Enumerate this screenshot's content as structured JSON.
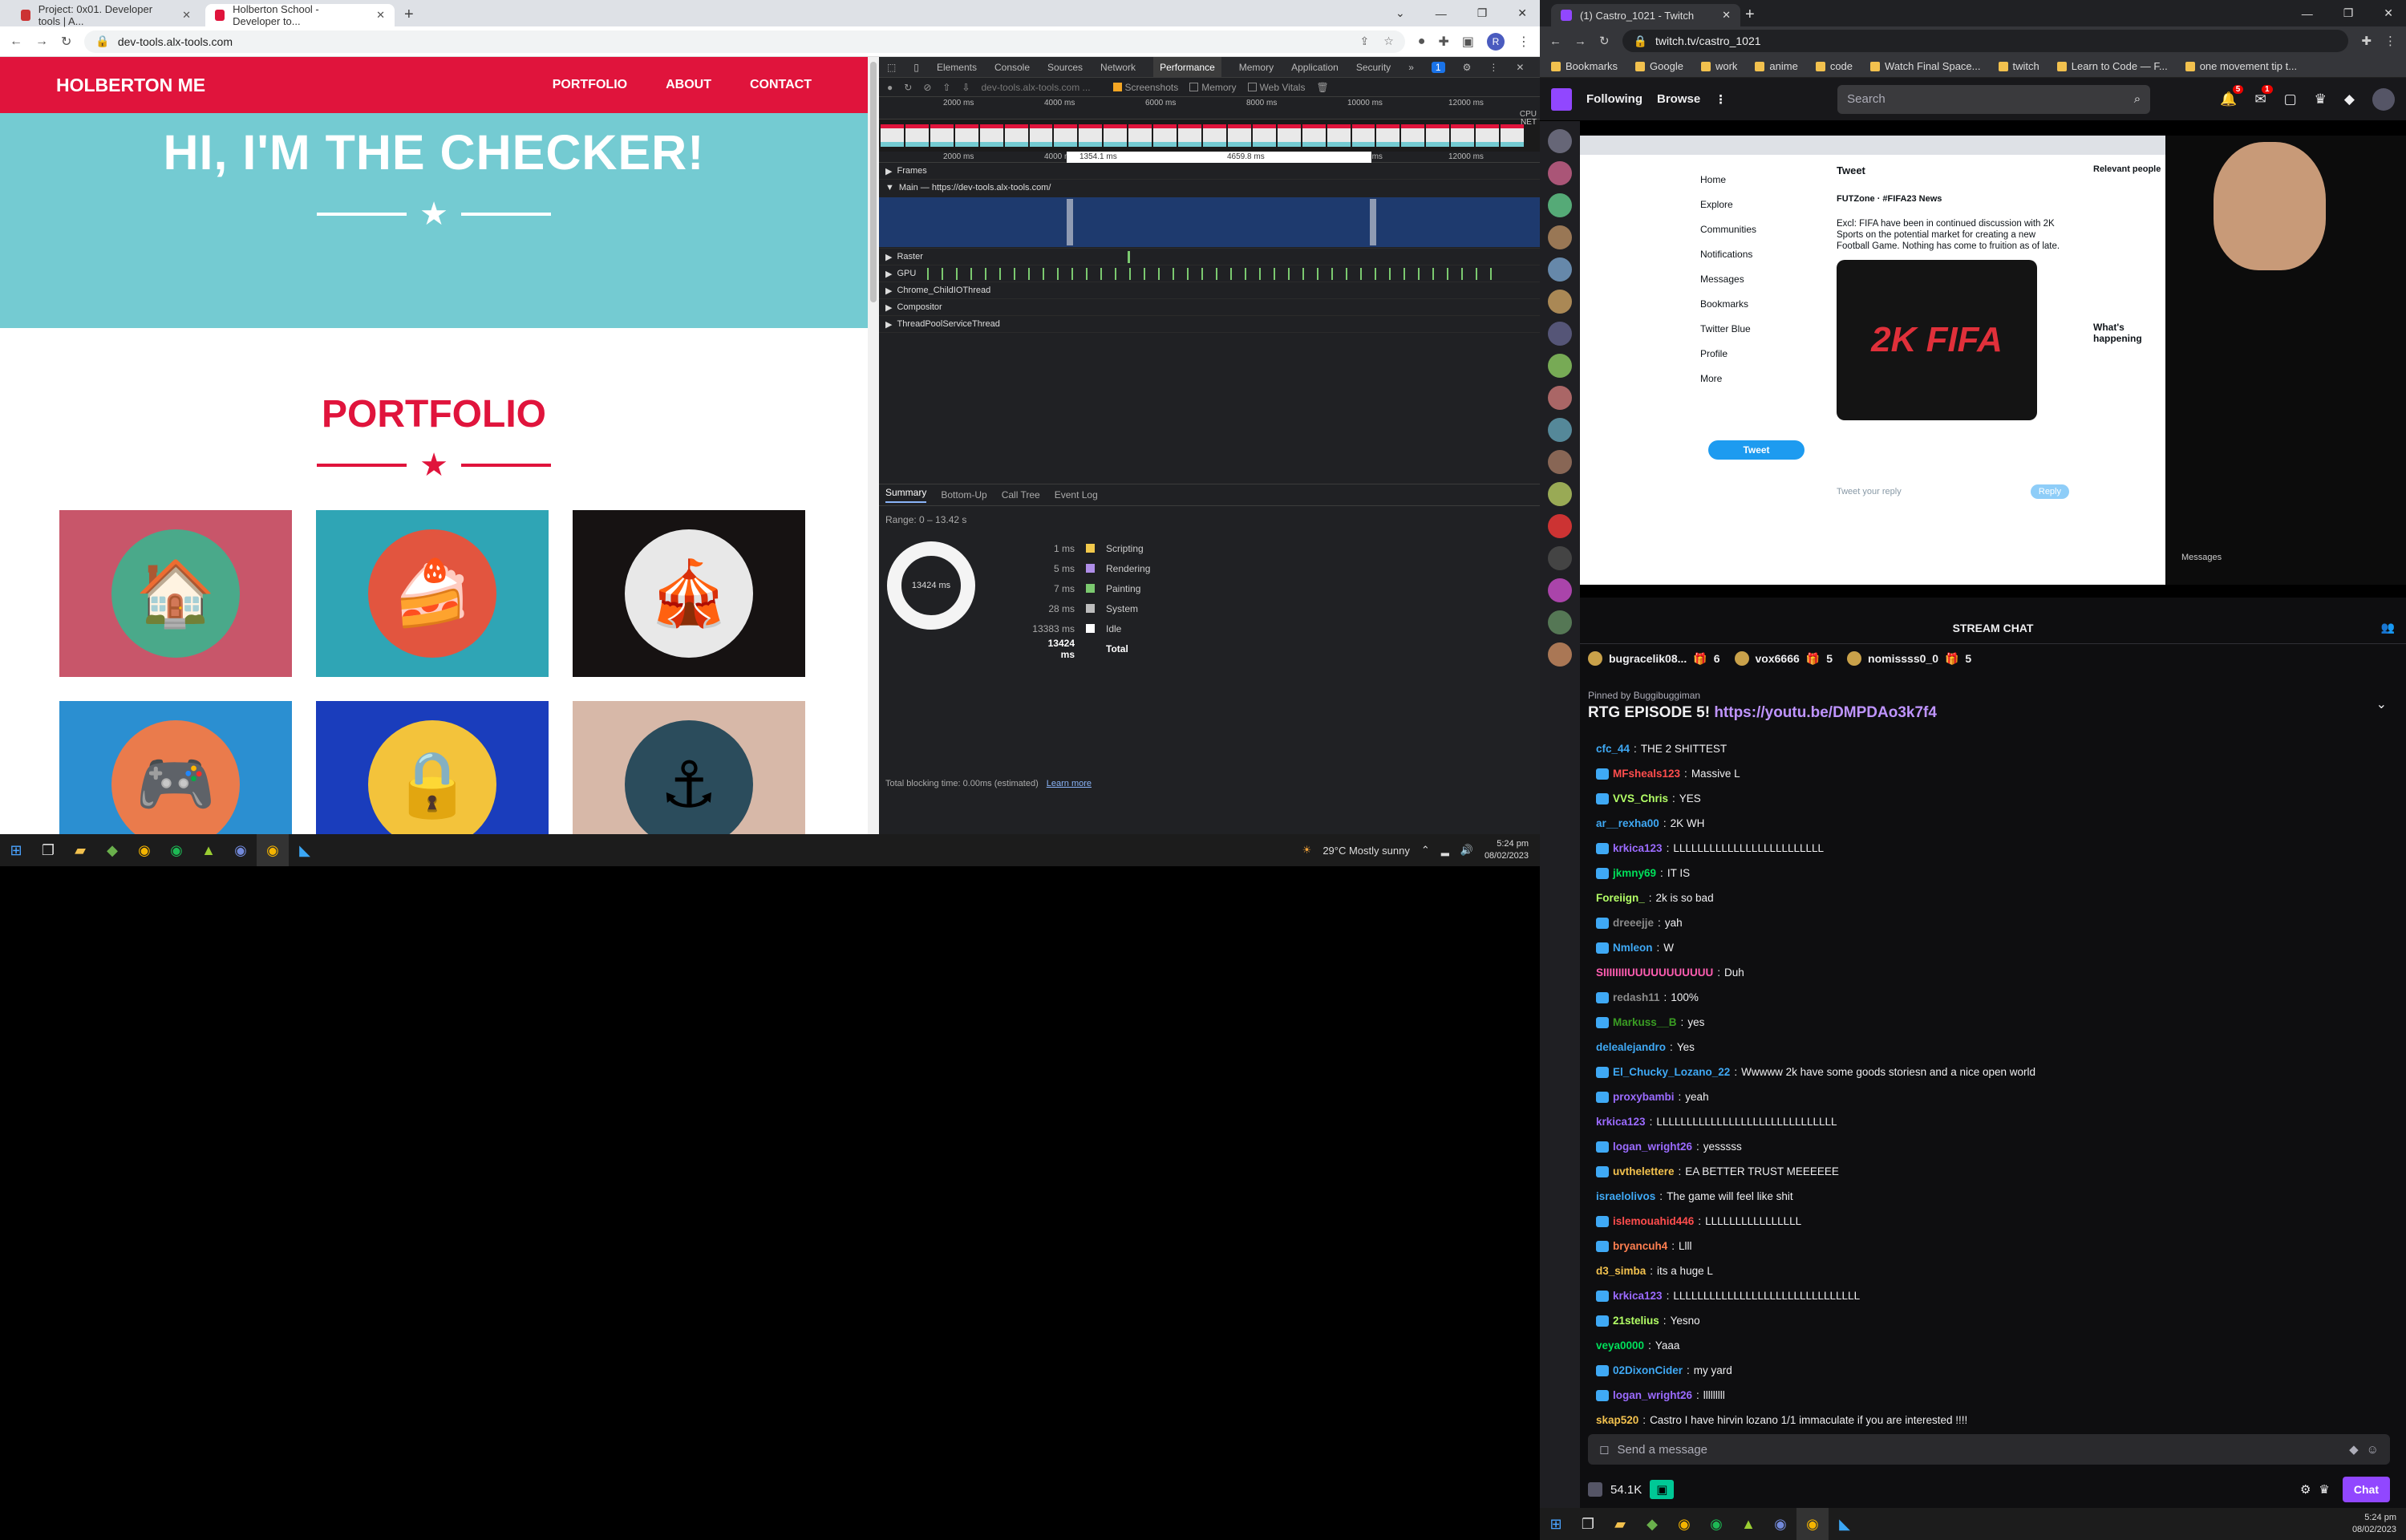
{
  "left_browser": {
    "tabs": [
      {
        "title": "Project: 0x01. Developer tools | A...",
        "active": false
      },
      {
        "title": "Holberton School - Developer to...",
        "active": true
      }
    ],
    "url": "dev-tools.alx-tools.com",
    "avatar_letter": "R"
  },
  "site": {
    "brand": "HOLBERTON ME",
    "nav": [
      "PORTFOLIO",
      "ABOUT",
      "CONTACT"
    ],
    "hero_title": "HI, I'M THE CHECKER!",
    "portfolio_title": "PORTFOLIO",
    "colors": {
      "accent": "#e0143c",
      "hero": "#74cbd2"
    },
    "cards": [
      {
        "bg": "#c8566a",
        "circle": "#4aa98a",
        "icon": "cabin-icon",
        "glyph": "🏠"
      },
      {
        "bg": "#2fa5b5",
        "circle": "#e2553f",
        "icon": "cake-icon",
        "glyph": "🍰"
      },
      {
        "bg": "#161212",
        "circle": "#e8e8e8",
        "icon": "circus-tent-icon",
        "glyph": "🎪"
      },
      {
        "bg": "#2b8fd1",
        "circle": "#ea7b4c",
        "icon": "game-controller-icon",
        "glyph": "🎮"
      },
      {
        "bg": "#1a3dbc",
        "circle": "#f3c33b",
        "icon": "safe-icon",
        "glyph": "🔒"
      },
      {
        "bg": "#d7b8a8",
        "circle": "#2b4c5c",
        "icon": "submarine-icon",
        "glyph": "⚓"
      }
    ]
  },
  "devtools": {
    "tabs": [
      "Elements",
      "Console",
      "Sources",
      "Network",
      "Performance",
      "Memory",
      "Application",
      "Security"
    ],
    "active_tab": "Performance",
    "badge": "1",
    "toolbar_url": "dev-tools.alx-tools.com ...",
    "checkboxes": [
      {
        "label": "Screenshots",
        "checked": true
      },
      {
        "label": "Memory",
        "checked": false
      },
      {
        "label": "Web Vitals",
        "checked": false
      }
    ],
    "ruler_top": [
      "2000 ms",
      "4000 ms",
      "6000 ms",
      "8000 ms",
      "10000 ms",
      "12000 ms"
    ],
    "ruler_bottom": [
      "2000 ms",
      "4000 ms",
      "6000 ms",
      "8000 ms",
      "10000 ms",
      "12000 ms",
      "140"
    ],
    "side_labels": [
      "CPU",
      "NET"
    ],
    "selection_left": "1354.1 ms",
    "selection_right": "4659.8 ms",
    "tracks": [
      "Frames",
      "Main — https://dev-tools.alx-tools.com/",
      "Raster",
      "GPU",
      "Chrome_ChildIOThread",
      "Compositor",
      "ThreadPoolServiceThread"
    ],
    "summary_tabs": [
      "Summary",
      "Bottom-Up",
      "Call Tree",
      "Event Log"
    ],
    "range": "Range: 0 – 13.42 s",
    "donut_label": "13424 ms",
    "breakdown": [
      {
        "value": "1 ms",
        "label": "Scripting",
        "color": "#f2c94c"
      },
      {
        "value": "5 ms",
        "label": "Rendering",
        "color": "#af8ee8"
      },
      {
        "value": "7 ms",
        "label": "Painting",
        "color": "#7bc96f"
      },
      {
        "value": "28 ms",
        "label": "System",
        "color": "#bdbdbd"
      },
      {
        "value": "13383 ms",
        "label": "Idle",
        "color": "#ffffff"
      }
    ],
    "total_value": "13424 ms",
    "total_label": "Total",
    "footer": "Total blocking time: 0.00ms (estimated)",
    "footer_link": "Learn more"
  },
  "taskbar": {
    "weather": "29°C  Mostly sunny",
    "time": "5:24 pm",
    "date": "08/02/2023"
  },
  "right_browser": {
    "tab_title": "(1) Castro_1021 - Twitch",
    "url": "twitch.tv/castro_1021",
    "bookmarks": [
      "Bookmarks",
      "Google",
      "work",
      "anime",
      "code",
      "Watch Final Space...",
      "twitch",
      "Learn to Code — F...",
      "one movement tip t..."
    ]
  },
  "twitch": {
    "nav": [
      "Following",
      "Browse"
    ],
    "search_placeholder": "Search",
    "notif_count": "5",
    "inbox_count": "1",
    "stream_chat_title": "STREAM CHAT",
    "gifters": [
      {
        "name": "bugracelik08...",
        "count": "6"
      },
      {
        "name": "vox6666",
        "count": "5"
      },
      {
        "name": "nomissss0_0",
        "count": "5"
      }
    ],
    "pinned_by": "Pinned by  Buggibuggiman",
    "pinned_text": "RTG EPISODE 5!",
    "pinned_link": "https://youtu.be/DMPDAo3k7f4",
    "messages": [
      {
        "user": "cfc_44",
        "color": "#3fa9f5",
        "text": "THE 2 SHITTEST"
      },
      {
        "user": "MFsheals123",
        "color": "#ff4d4d",
        "text": "Massive L"
      },
      {
        "user": "VVS_Chris",
        "color": "#b3ff66",
        "text": "YES"
      },
      {
        "user": "ar__rexha00",
        "color": "#3fa9f5",
        "text": "2K WH"
      },
      {
        "user": "krkica123",
        "color": "#9b6bff",
        "text": "LLLLLLLLLLLLLLLLLLLLLLLLL"
      },
      {
        "user": "jkmny69",
        "color": "#00e05a",
        "text": "IT IS"
      },
      {
        "user": "Foreiign_",
        "color": "#b3ff66",
        "text": "2k is so bad"
      },
      {
        "user": "dreeejje",
        "color": "#8a8a8a",
        "text": "yah"
      },
      {
        "user": "Nmleon",
        "color": "#3fa9f5",
        "text": "W"
      },
      {
        "user": "SIIIIIIIIUUUUUUUUUUU",
        "color": "#ff5db1",
        "text": "Duh"
      },
      {
        "user": "redash11",
        "color": "#8a8a8a",
        "text": "100%"
      },
      {
        "user": "Markuss__B",
        "color": "#3a9d23",
        "text": "yes"
      },
      {
        "user": "delealejandro",
        "color": "#3fa9f5",
        "text": "Yes"
      },
      {
        "user": "El_Chucky_Lozano_22",
        "color": "#3fa9f5",
        "text": "Wwwww 2k have some goods storiesn and a nice open world"
      },
      {
        "user": "proxybambi",
        "color": "#9b6bff",
        "text": "yeah"
      },
      {
        "user": "krkica123",
        "color": "#9b6bff",
        "text": "LLLLLLLLLLLLLLLLLLLLLLLLLLLLLL"
      },
      {
        "user": "logan_wright26",
        "color": "#9b6bff",
        "text": "yesssss"
      },
      {
        "user": "uvthelettere",
        "color": "#f2c14e",
        "text": "EA BETTER TRUST MEEEEEE"
      },
      {
        "user": "israelolivos",
        "color": "#3fa9f5",
        "text": "The game will feel like shit"
      },
      {
        "user": "islemouahid446",
        "color": "#ff4d4d",
        "text": "LLLLLLLLLLLLLLLL"
      },
      {
        "user": "bryancuh4",
        "color": "#ff7f50",
        "text": "Llll"
      },
      {
        "user": "d3_simba",
        "color": "#f2c14e",
        "text": "its a huge L"
      },
      {
        "user": "krkica123",
        "color": "#9b6bff",
        "text": "LLLLLLLLLLLLLLLLLLLLLLLLLLLLLLL"
      },
      {
        "user": "21stelius",
        "color": "#b3ff66",
        "text": "Yesno"
      },
      {
        "user": "veya0000",
        "color": "#00e05a",
        "text": "Yaaa"
      },
      {
        "user": "02DixonCider",
        "color": "#3fa9f5",
        "text": "my yard"
      },
      {
        "user": "logan_wright26",
        "color": "#9b6bff",
        "text": "lllllllll"
      },
      {
        "user": "skap520",
        "color": "#f2c14e",
        "text": "Castro I have hirvin lozano 1/1 immaculate if you are interested !!!!"
      }
    ],
    "send_placeholder": "Send a message",
    "points": "54.1K",
    "chat_button": "Chat",
    "video": {
      "tweet_header": "Tweet",
      "tweet_author": "FUTZone · #FIFA23 News",
      "tweet_text": "Excl: FIFA have been in continued discussion with 2K Sports on the potential market for creating a new Football Game. Nothing has come to fruition as of late.",
      "tweet_image_text": "2K FIFA",
      "tweet_button": "Tweet",
      "twitter_menu": [
        "Home",
        "Explore",
        "Communities",
        "Notifications",
        "Messages",
        "Bookmarks",
        "Twitter Blue",
        "Profile",
        "More"
      ],
      "reply_placeholder": "Tweet your reply",
      "reply_button": "Reply",
      "whats_happening": "What's happening",
      "relevant": "Relevant people",
      "messages_label": "Messages"
    }
  },
  "taskbar2": {
    "time": "5:24 pm",
    "date": "08/02/2023"
  }
}
